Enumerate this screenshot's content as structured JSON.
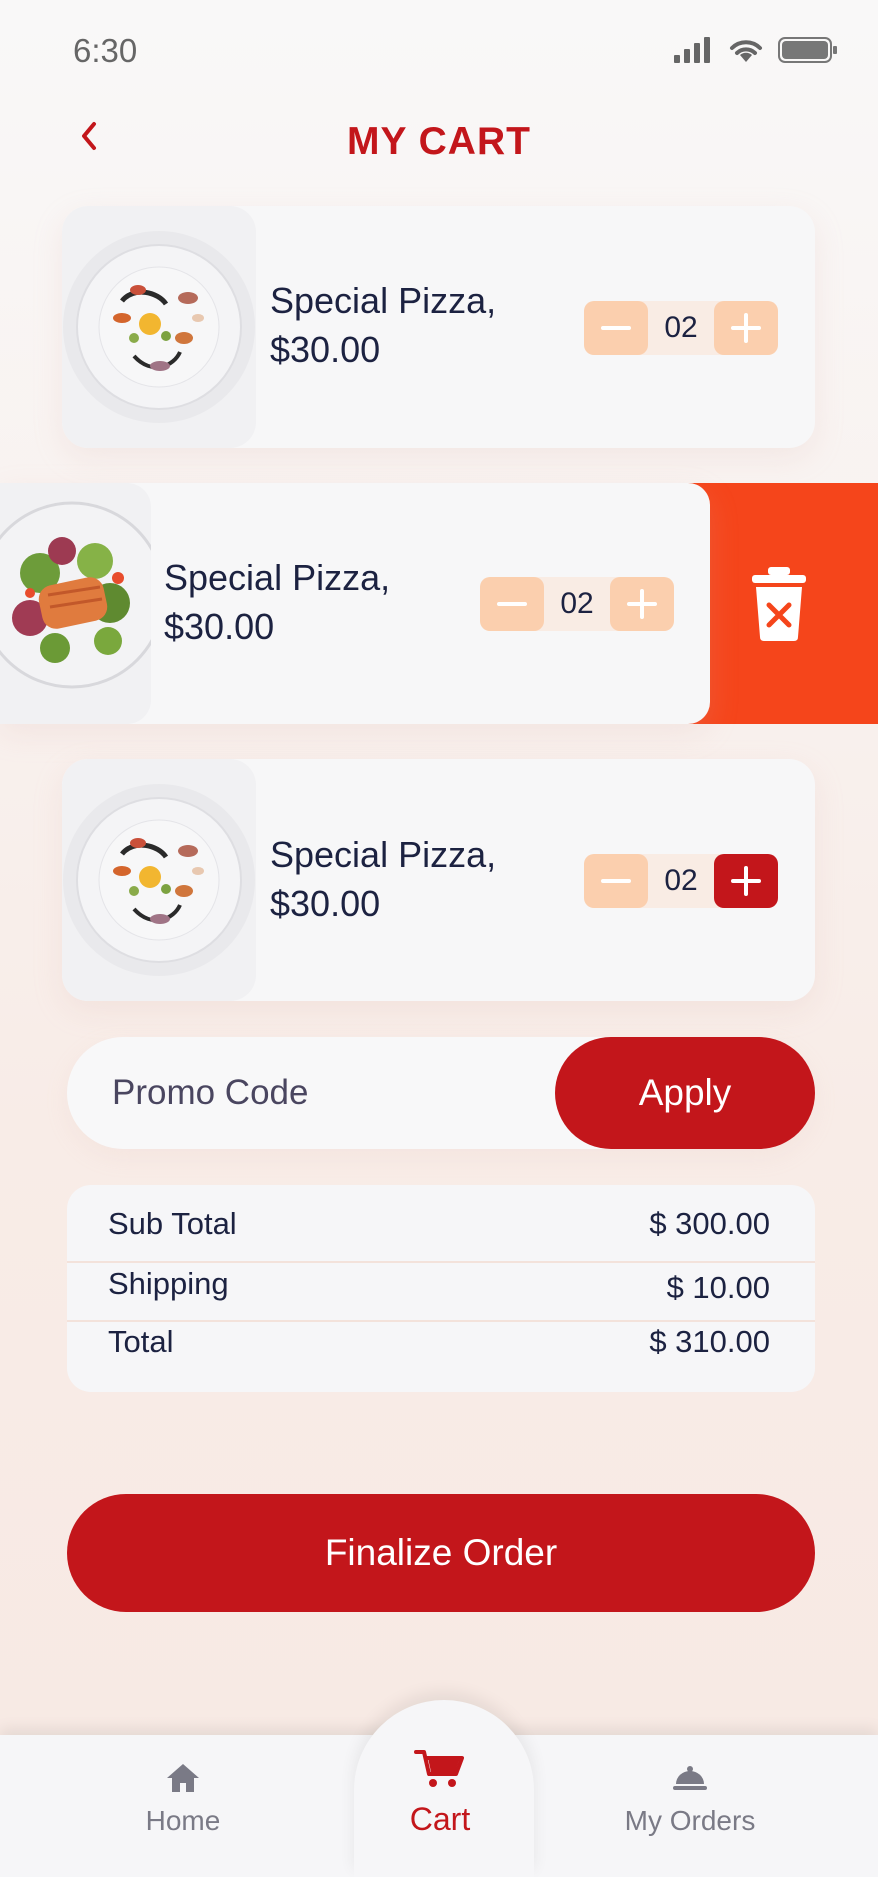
{
  "status_bar": {
    "time": "6:30"
  },
  "header": {
    "title": "MY CART"
  },
  "cart": {
    "items": [
      {
        "name": "Special Pizza,",
        "price": "$30.00",
        "quantity": "02"
      },
      {
        "name": "Special Pizza,",
        "price": "$30.00",
        "quantity": "02"
      },
      {
        "name": "Special Pizza,",
        "price": "$30.00",
        "quantity": "02"
      }
    ]
  },
  "promo": {
    "placeholder": "Promo Code",
    "apply_label": "Apply"
  },
  "summary": {
    "subtotal_label": "Sub Total",
    "subtotal_value": "$ 300.00",
    "shipping_label": "Shipping",
    "shipping_value": "$ 10.00",
    "total_label": "Total",
    "total_value": "$ 310.00"
  },
  "finalize_label": "Finalize Order",
  "nav": {
    "home": "Home",
    "cart": "Cart",
    "orders": "My Orders"
  },
  "colors": {
    "brand_red": "#c3161b",
    "delete_orange": "#f5451b",
    "stepper_peach": "#fbcfae"
  },
  "icons": [
    "back-arrow-icon",
    "signal-icon",
    "wifi-icon",
    "battery-icon",
    "trash-icon",
    "minus-icon",
    "plus-icon",
    "home-icon",
    "cart-icon",
    "cloche-icon"
  ]
}
